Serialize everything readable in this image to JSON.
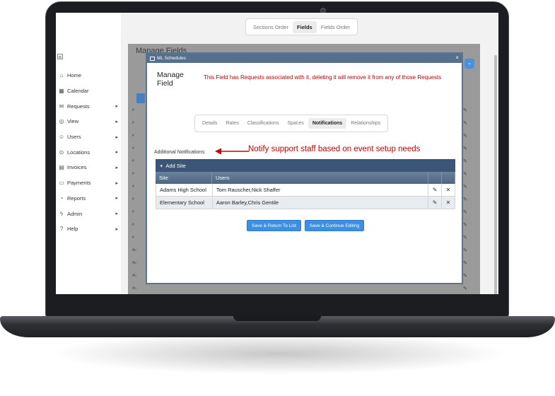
{
  "top_tabs": {
    "sections_order": "Sections Order",
    "fields": "Fields",
    "fields_order": "Fields Order"
  },
  "sidebar": {
    "items": [
      {
        "label": "Home",
        "icon": "⌂",
        "has_submenu": false
      },
      {
        "label": "Calendar",
        "icon": "▦",
        "has_submenu": false
      },
      {
        "label": "Requests",
        "icon": "✉",
        "has_submenu": true
      },
      {
        "label": "View",
        "icon": "◎",
        "has_submenu": true
      },
      {
        "label": "Users",
        "icon": "☺",
        "has_submenu": true
      },
      {
        "label": "Locations",
        "icon": "⊙",
        "has_submenu": true
      },
      {
        "label": "Invoices",
        "icon": "▤",
        "has_submenu": true
      },
      {
        "label": "Payments",
        "icon": "▭",
        "has_submenu": true
      },
      {
        "label": "Reports",
        "icon": "◔",
        "has_submenu": true
      },
      {
        "label": "Admin",
        "icon": "ϟ",
        "has_submenu": true
      },
      {
        "label": "Help",
        "icon": "?",
        "has_submenu": true
      }
    ]
  },
  "background": {
    "title": "Manage Fields",
    "row_labels": [
      "#",
      "#",
      "#",
      "#",
      "#",
      "#",
      "#",
      "#",
      "#",
      "#",
      "#",
      "Ac",
      "Ac",
      "Ac",
      "Ac",
      "Ac",
      "Ac"
    ]
  },
  "modal": {
    "window_title": "ML Schedules",
    "close": "×",
    "title": "Manage Field",
    "warning": "This Field has Requests associated with it, deleting it will remove it from any of those Requests",
    "tabs": [
      "Details",
      "Rates",
      "Classifications",
      "Spaces",
      "Notifications",
      "Relationships"
    ],
    "active_tab": "Notifications",
    "additional_label": "Additional Notifications:",
    "callout": "Notify support staff based on event setup needs",
    "grid": {
      "add_label": "Add Site",
      "columns": [
        "Site",
        "Users"
      ],
      "rows": [
        {
          "site": "Adams High School",
          "users": "Tom Rauscher,Nick Shaffer"
        },
        {
          "site": "Elementary School",
          "users": "Aaron Barley,Chris Gentile"
        }
      ]
    },
    "buttons": {
      "save_return": "Save & Return To List",
      "save_continue": "Save & Continue Editing"
    }
  },
  "colors": {
    "accent": "#3d8fe4",
    "warning": "#c00000",
    "header": "#3b5576"
  }
}
